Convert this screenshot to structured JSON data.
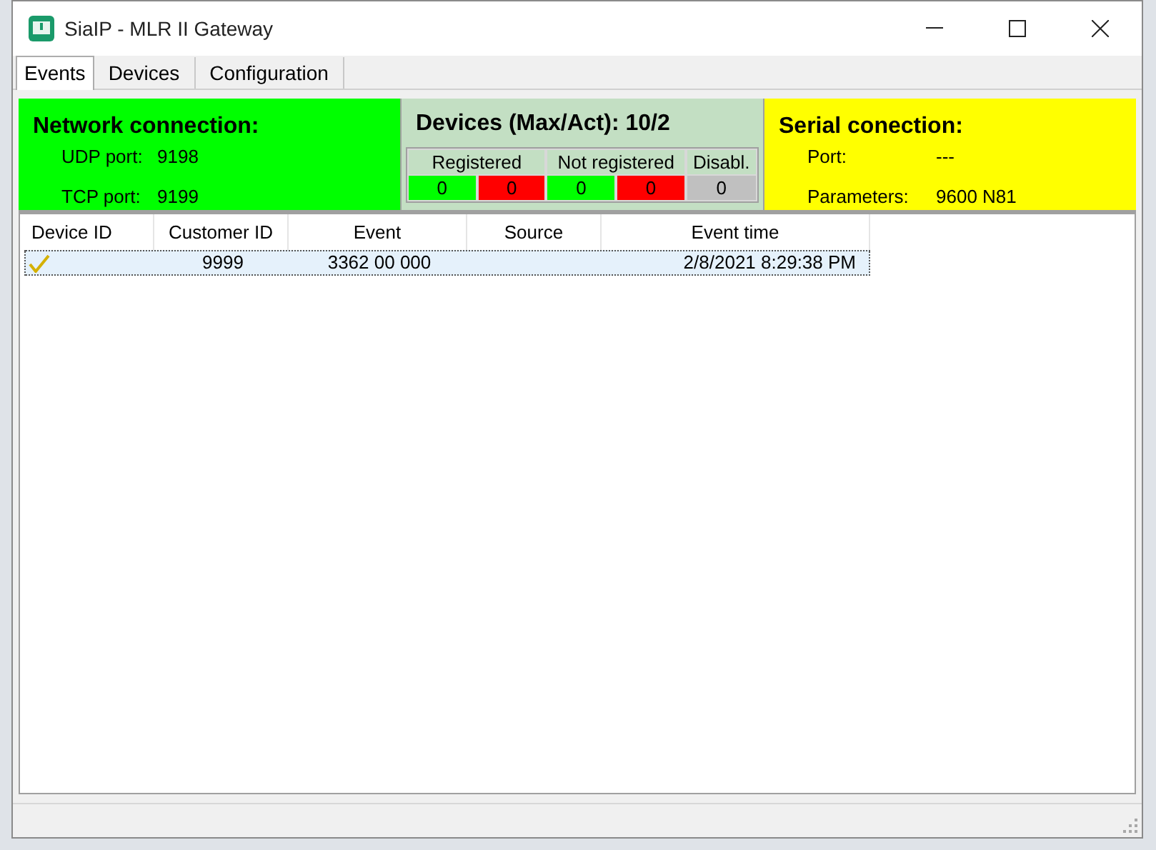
{
  "window": {
    "title": "SiaIP - MLR II Gateway"
  },
  "tabs": [
    {
      "label": "Events",
      "selected": true
    },
    {
      "label": "Devices",
      "selected": false
    },
    {
      "label": "Configuration",
      "selected": false
    }
  ],
  "network": {
    "title": "Network connection:",
    "fields": [
      {
        "label": "UDP port:",
        "value": "9198"
      },
      {
        "label": "TCP port:",
        "value": "9199"
      }
    ]
  },
  "devices": {
    "title": "Devices (Max/Act):  10/2",
    "groups": [
      {
        "label": "Registered",
        "counters": [
          {
            "value": "0",
            "color": "#00ff00"
          },
          {
            "value": "0",
            "color": "#ff0000"
          }
        ]
      },
      {
        "label": "Not registered",
        "counters": [
          {
            "value": "0",
            "color": "#00ff00"
          },
          {
            "value": "0",
            "color": "#ff0000"
          }
        ]
      },
      {
        "label": "Disabl.",
        "counters": [
          {
            "value": "0",
            "color": "#c0c0c0"
          }
        ]
      }
    ]
  },
  "serial": {
    "title": "Serial conection:",
    "fields": [
      {
        "label": "Port:",
        "value": "---"
      },
      {
        "label": "Parameters:",
        "value": "9600 N81"
      }
    ]
  },
  "table": {
    "columns": [
      "Device ID",
      "Customer ID",
      "Event",
      "Source",
      "Event time"
    ],
    "rows": [
      {
        "checked": true,
        "selected": true,
        "cells": [
          "",
          "9999",
          "3362 00 000",
          "",
          "2/8/2021 8:29:38 PM"
        ]
      }
    ]
  }
}
